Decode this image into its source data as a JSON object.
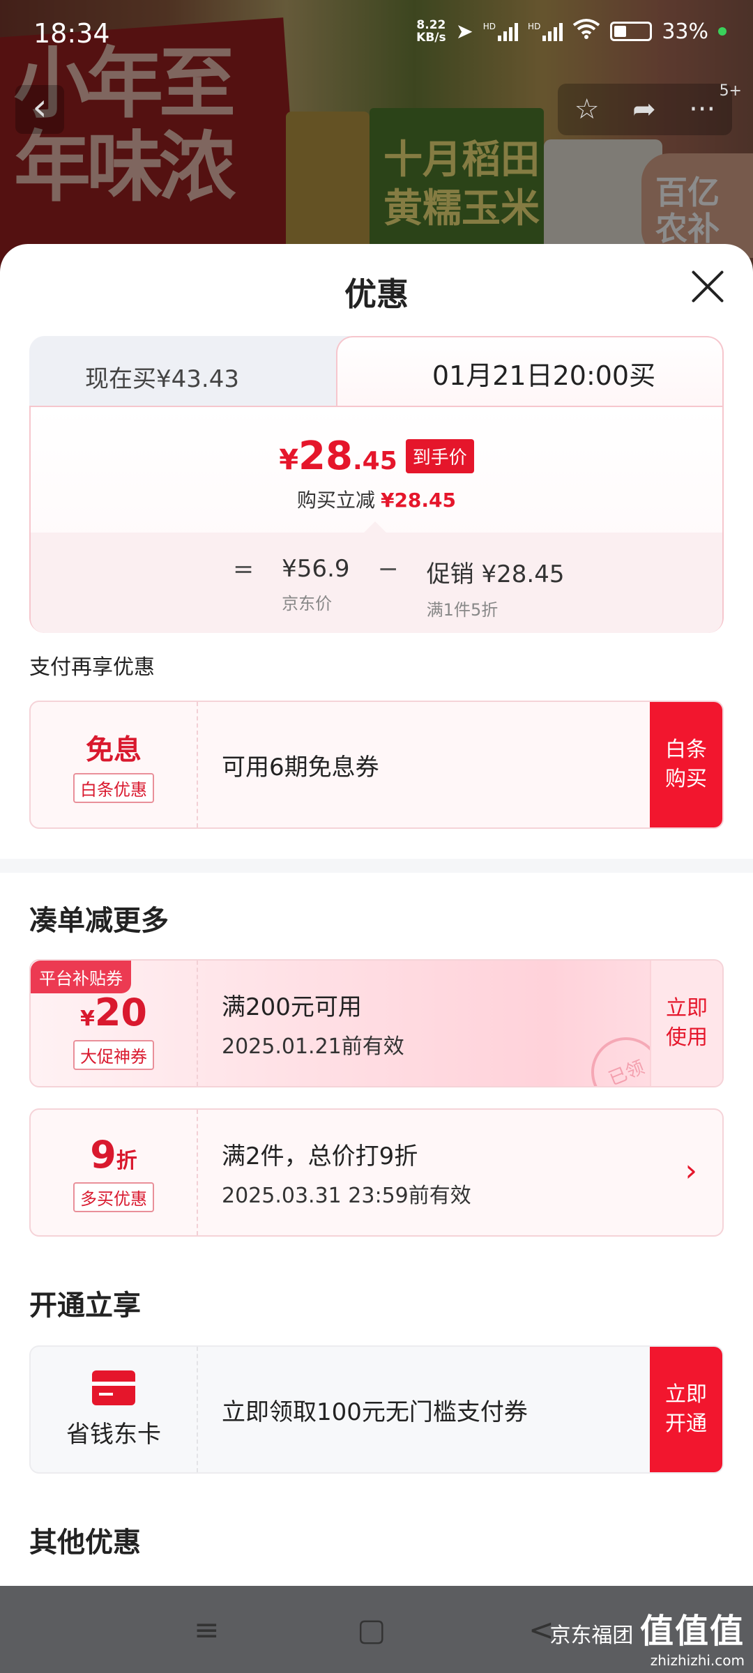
{
  "status": {
    "time": "18:34",
    "net_speed_value": "8.22",
    "net_speed_unit": "KB/s",
    "battery": "33%",
    "hd1": "HD",
    "hd2": "HD"
  },
  "background": {
    "poster_text": "小年至\n年味浓",
    "box_text": "十月稻田\n黄糯玉米",
    "badge_text": "百亿\n农补",
    "nav_badge": "5+"
  },
  "sheet": {
    "title": "优惠",
    "tab_now": "现在买¥43.43",
    "tab_later": "01月21日20:00买",
    "final_currency": "¥",
    "final_int": "28",
    "final_dec": ".45",
    "final_tag": "到手价",
    "sub_label": "购买立减",
    "sub_value": "¥28.45",
    "formula_eq": "=",
    "jd_price": "¥56.9",
    "jd_price_label": "京东价",
    "formula_minus": "−",
    "promo": "促销 ¥28.45",
    "promo_label": "满1件5折"
  },
  "pay_section": {
    "label": "支付再享优惠",
    "left_main": "免息",
    "left_chip": "白条优惠",
    "text": "可用6期免息券",
    "button": "白条\n购买"
  },
  "more_section": {
    "title": "凑单减更多",
    "coupon1": {
      "corner": "平台补贴券",
      "currency": "¥",
      "amount": "20",
      "chip": "大促神券",
      "line1": "满200元可用",
      "line2": "2025.01.21前有效",
      "seal": "已领",
      "button": "立即\n使用"
    },
    "coupon2": {
      "amount": "9",
      "unit": "折",
      "chip": "多买优惠",
      "line1": "满2件，总价打9折",
      "line2": "2025.03.31 23:59前有效",
      "arrow": "›"
    }
  },
  "open_section": {
    "title": "开通立享",
    "left_label": "省钱东卡",
    "text": "立即领取100元无门槛支付券",
    "button": "立即\n开通"
  },
  "other_section": {
    "title": "其他优惠"
  },
  "navbar": {
    "menu_icon": "≡",
    "home_icon": "▢",
    "back_icon": "<"
  },
  "watermark": {
    "line1": "京东福团",
    "brand": "值值值",
    "site": "zhizhizhi.com"
  }
}
